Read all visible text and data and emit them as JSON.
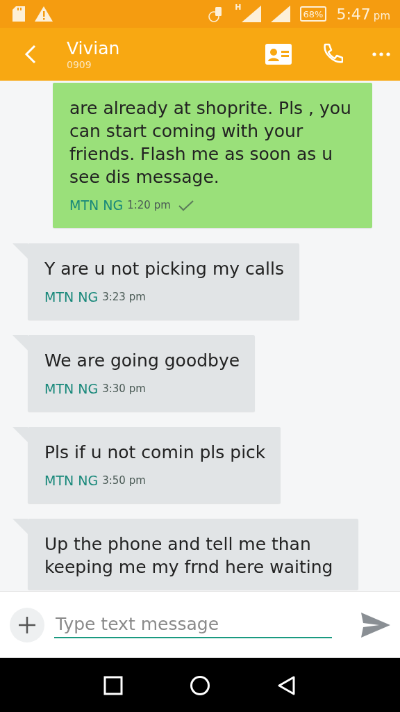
{
  "status_bar": {
    "battery": "68%",
    "network_type": "H",
    "time": "5:47",
    "time_suffix": "pm"
  },
  "header": {
    "title": "Vivian",
    "subtitle": "0909"
  },
  "messages": [
    {
      "kind": "sent",
      "text": "are already at shoprite. Pls , you can start coming with your friends. Flash me as soon as u see dis message.",
      "sender": "MTN NG",
      "time": "1:20 pm"
    },
    {
      "kind": "received",
      "text": "Y are u not picking my calls",
      "sender": "MTN NG",
      "time": "3:23 pm"
    },
    {
      "kind": "received",
      "text": "We are going goodbye",
      "sender": "MTN NG",
      "time": "3:30 pm"
    },
    {
      "kind": "received",
      "text": "Pls if u not comin pls pick",
      "sender": "MTN NG",
      "time": "3:50 pm"
    },
    {
      "kind": "received",
      "text": "Up the phone and tell me than keeping me my frnd here waiting"
    }
  ],
  "composer": {
    "placeholder": "Type text message"
  }
}
